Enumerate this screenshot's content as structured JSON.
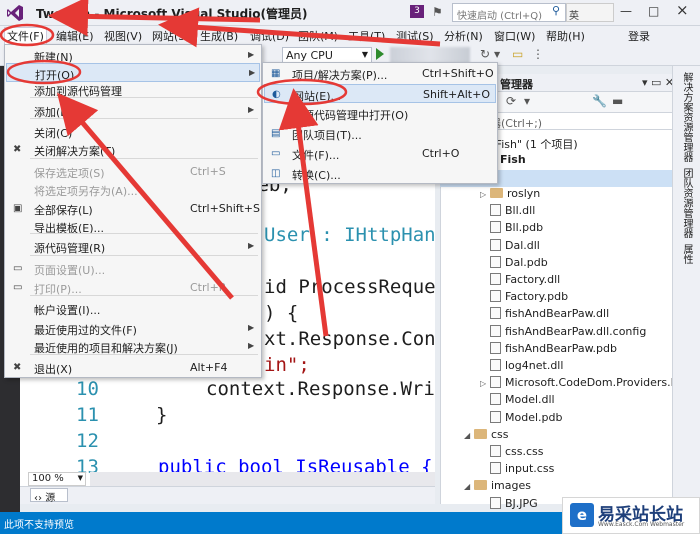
{
  "window": {
    "title": "TwoFish - Microsoft Visual Studio(管理员)",
    "notification_count": "3",
    "quick_launch_placeholder": "快速启动 (Ctrl+Q)",
    "ime_label": "英",
    "minimize": "—",
    "maximize": "□",
    "close": "×"
  },
  "menubar": {
    "items": [
      "文件(F)",
      "编辑(E)",
      "视图(V)",
      "网站(S)",
      "生成(B)",
      "调试(D)",
      "团队(M)",
      "工具(T)",
      "测试(S)",
      "分析(N)",
      "窗口(W)",
      "帮助(H)"
    ],
    "login": "登录"
  },
  "toolbar": {
    "platform": "Any CPU"
  },
  "file_menu": {
    "items": [
      {
        "label": "新建(N)",
        "shortcut": "",
        "submenu": true
      },
      {
        "label": "打开(O)",
        "shortcut": "",
        "submenu": true
      },
      {
        "label": "添加到源代码管理",
        "shortcut": ""
      },
      {
        "label": "添加(D)",
        "shortcut": "",
        "submenu": true
      },
      {
        "label": "关闭(C)",
        "shortcut": ""
      },
      {
        "label": "关闭解决方案(T)",
        "shortcut": ""
      },
      {
        "label": "保存选定项(S)",
        "shortcut": "Ctrl+S"
      },
      {
        "label": "将选定项另存为(A)...",
        "shortcut": ""
      },
      {
        "label": "全部保存(L)",
        "shortcut": "Ctrl+Shift+S"
      },
      {
        "label": "导出模板(E)...",
        "shortcut": ""
      },
      {
        "label": "源代码管理(R)",
        "shortcut": "",
        "submenu": true
      },
      {
        "label": "页面设置(U)...",
        "shortcut": ""
      },
      {
        "label": "打印(P)...",
        "shortcut": "Ctrl+P"
      },
      {
        "label": "帐户设置(I)...",
        "shortcut": ""
      },
      {
        "label": "最近使用过的文件(F)",
        "shortcut": "",
        "submenu": true
      },
      {
        "label": "最近使用的项目和解决方案(J)",
        "shortcut": "",
        "submenu": true
      },
      {
        "label": "退出(X)",
        "shortcut": "Alt+F4"
      }
    ]
  },
  "open_submenu": {
    "items": [
      {
        "label": "项目/解决方案(P)...",
        "shortcut": "Ctrl+Shift+O"
      },
      {
        "label": "网站(E)...",
        "shortcut": "Shift+Alt+O"
      },
      {
        "label": "在源代码管理中打开(O)",
        "shortcut": ""
      },
      {
        "label": "团队项目(T)...",
        "shortcut": ""
      },
      {
        "label": "文件(F)...",
        "shortcut": "Ctrl+O"
      },
      {
        "label": "转换(C)...",
        "shortcut": ""
      }
    ]
  },
  "editor": {
    "fragments": {
      "web": "Web;",
      "iface": "User : IHttpHan",
      "method": "id ProcessReque",
      "brace": ") {",
      "resp": "xt.Response.Con",
      "str": "in\";",
      "l10": "context.Response.Wri",
      "l11": "}",
      "l13": "public bool IsReusable {"
    },
    "line_numbers": [
      "10",
      "11",
      "12",
      "13"
    ],
    "zoom": "100 %",
    "source_tab": "源"
  },
  "solution_explorer": {
    "header": "管理器",
    "search_placeholder": "资源管理器(Ctrl+;)",
    "solution_line": "\"TwoFish\" (1 个项目)",
    "project_name": "Fish",
    "bin_folder": "n",
    "items": [
      {
        "label": "roslyn",
        "kind": "folder"
      },
      {
        "label": "Bll.dll",
        "kind": "file"
      },
      {
        "label": "Bll.pdb",
        "kind": "file"
      },
      {
        "label": "Dal.dll",
        "kind": "file"
      },
      {
        "label": "Dal.pdb",
        "kind": "file"
      },
      {
        "label": "Factory.dll",
        "kind": "file"
      },
      {
        "label": "Factory.pdb",
        "kind": "file"
      },
      {
        "label": "fishAndBearPaw.dll",
        "kind": "file"
      },
      {
        "label": "fishAndBearPaw.dll.config",
        "kind": "file"
      },
      {
        "label": "fishAndBearPaw.pdb",
        "kind": "file"
      },
      {
        "label": "log4net.dll",
        "kind": "file"
      },
      {
        "label": "Microsoft.CodeDom.Providers.Do",
        "kind": "file"
      },
      {
        "label": "Model.dll",
        "kind": "file"
      },
      {
        "label": "Model.pdb",
        "kind": "file"
      },
      {
        "label": "css",
        "kind": "folder"
      },
      {
        "label": "css.css",
        "kind": "file"
      },
      {
        "label": "input.css",
        "kind": "file"
      },
      {
        "label": "images",
        "kind": "folder"
      },
      {
        "label": "BJ.JPG",
        "kind": "file"
      },
      {
        "label": "brows",
        "kind": "file"
      },
      {
        "label": "css",
        "kind": "file"
      }
    ]
  },
  "right_tabs": [
    "解决方案资源管理器",
    "团队资源管理器",
    "属性"
  ],
  "status": {
    "text": "此项不支持预览"
  },
  "watermark": {
    "text": "易采站长站",
    "sub": "Www.Easck.Com Webmaster"
  },
  "colors": {
    "accent": "#007acc",
    "annotation": "#e53935",
    "vs_purple": "#68217a"
  }
}
